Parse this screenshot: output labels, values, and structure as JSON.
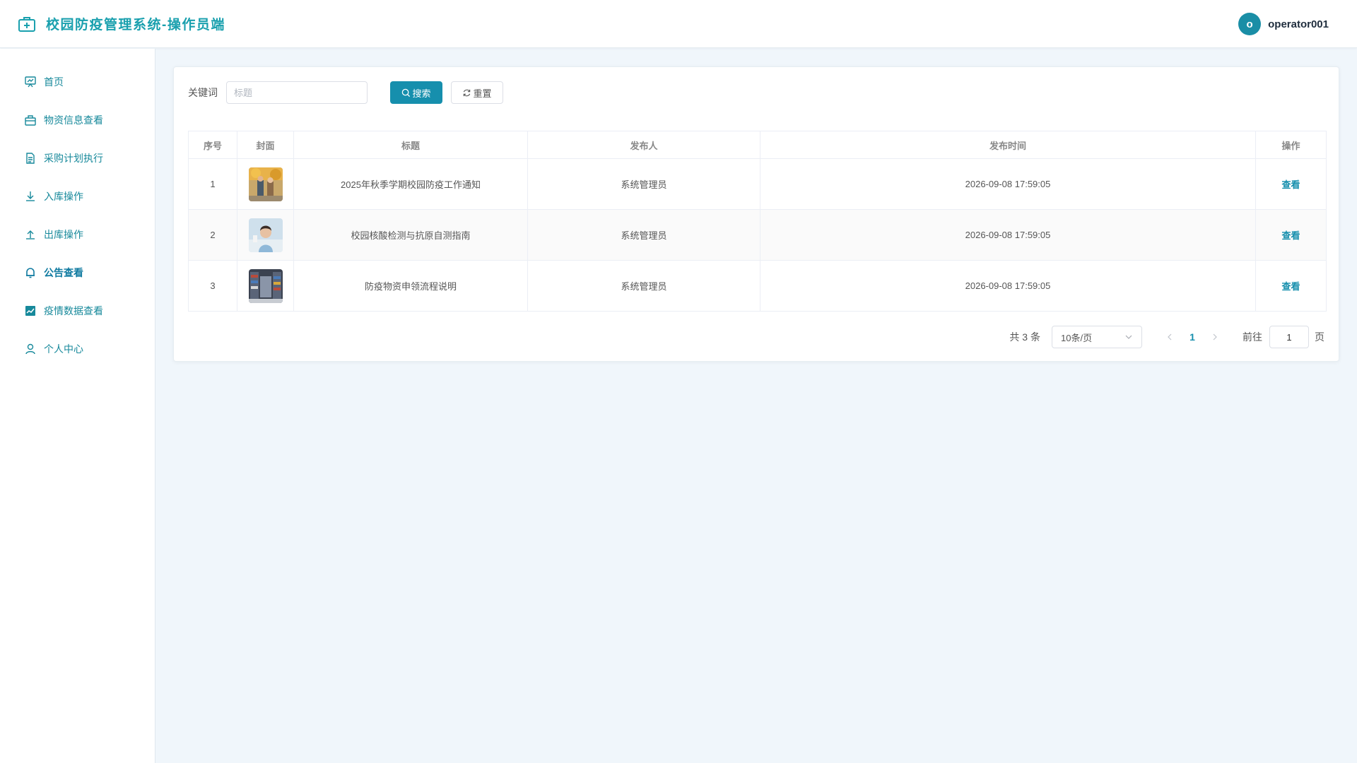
{
  "header": {
    "title": "校园防疫管理系统-操作员端",
    "user_initial": "o",
    "username": "operator001"
  },
  "sidebar": {
    "items": [
      {
        "label": "首页",
        "icon": "dashboard-icon"
      },
      {
        "label": "物资信息查看",
        "icon": "box-icon"
      },
      {
        "label": "采购计划执行",
        "icon": "document-icon"
      },
      {
        "label": "入库操作",
        "icon": "download-icon"
      },
      {
        "label": "出库操作",
        "icon": "upload-icon"
      },
      {
        "label": "公告查看",
        "icon": "bell-icon",
        "active": true
      },
      {
        "label": "疫情数据查看",
        "icon": "chart-icon"
      },
      {
        "label": "个人中心",
        "icon": "user-icon"
      }
    ]
  },
  "search": {
    "label": "关键词",
    "placeholder": "标题",
    "value": "",
    "search_label": "搜索",
    "reset_label": "重置"
  },
  "table": {
    "headers": [
      "序号",
      "封面",
      "标题",
      "发布人",
      "发布时间",
      "操作"
    ],
    "rows": [
      {
        "index": "1",
        "title": "2025年秋季学期校园防疫工作通知",
        "publisher": "系统管理员",
        "time": "2026-09-08 17:59:05",
        "action": "查看"
      },
      {
        "index": "2",
        "title": "校园核酸检测与抗原自测指南",
        "publisher": "系统管理员",
        "time": "2026-09-08 17:59:05",
        "action": "查看"
      },
      {
        "index": "3",
        "title": "防疫物资申领流程说明",
        "publisher": "系统管理员",
        "time": "2026-09-08 17:59:05",
        "action": "查看"
      }
    ]
  },
  "pagination": {
    "total_text": "共 3 条",
    "page_size": "10条/页",
    "current_page": "1",
    "goto_label": "前往",
    "goto_value": "1",
    "page_suffix": "页"
  },
  "colors": {
    "accent": "#168fad",
    "brand_title": "#1aa0ae",
    "background": "#f0f6fb"
  }
}
